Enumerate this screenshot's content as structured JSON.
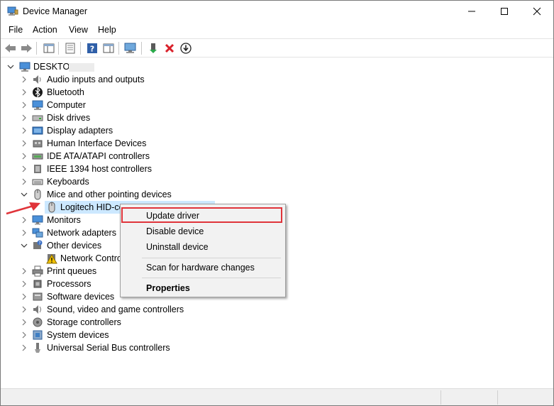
{
  "window": {
    "title": "Device Manager"
  },
  "menu": [
    "File",
    "Action",
    "View",
    "Help"
  ],
  "toolbar": {
    "icons": [
      "back-arrow-icon",
      "forward-arrow-icon",
      "show-hide-tree-icon",
      "properties-icon",
      "help-icon",
      "action-pane-icon",
      "scan-hardware-icon",
      "enable-device-icon",
      "uninstall-icon",
      "update-driver-icon"
    ]
  },
  "tree": {
    "root": "DESKTOP",
    "categories": [
      "Audio inputs and outputs",
      "Bluetooth",
      "Computer",
      "Disk drives",
      "Display adapters",
      "Human Interface Devices",
      "IDE ATA/ATAPI controllers",
      "IEEE 1394 host controllers",
      "Keyboards",
      "Mice and other pointing devices",
      "Monitors",
      "Network adapters",
      "Other devices",
      "Print queues",
      "Processors",
      "Software devices",
      "Sound, video and game controllers",
      "Storage controllers",
      "System devices",
      "Universal Serial Bus controllers"
    ],
    "mice_child": "Logitech HID-co",
    "other_child": "Network Contro"
  },
  "context_menu": {
    "update": "Update driver",
    "disable": "Disable device",
    "uninstall": "Uninstall device",
    "scan": "Scan for hardware changes",
    "properties": "Properties"
  },
  "colors": {
    "selection": "#cce8ff",
    "highlight_box": "#e0343a",
    "arrow": "#e0343a"
  }
}
